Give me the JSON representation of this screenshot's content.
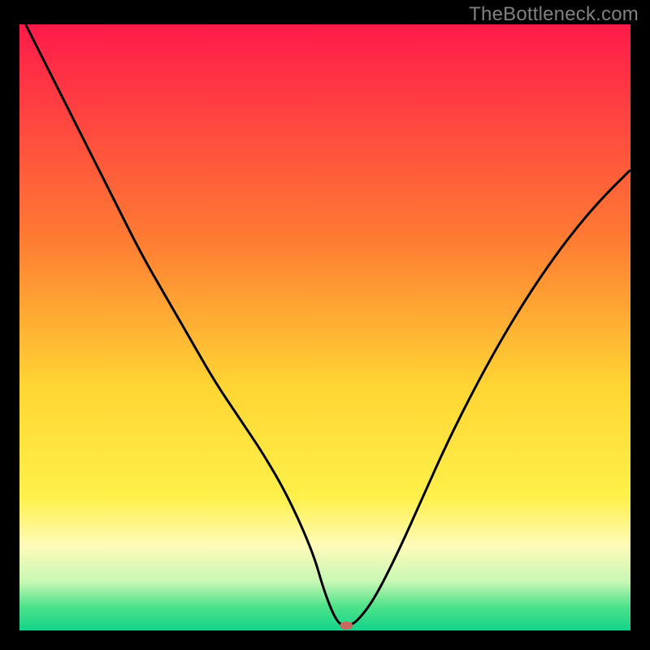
{
  "watermark": "TheBottleneck.com",
  "chart_data": {
    "type": "line",
    "title": "",
    "xlabel": "",
    "ylabel": "",
    "xlim": [
      0,
      100
    ],
    "ylim": [
      0,
      100
    ],
    "background_gradient": {
      "stops": [
        {
          "offset": 0,
          "color": "#ff1a4a"
        },
        {
          "offset": 35,
          "color": "#ff7a33"
        },
        {
          "offset": 60,
          "color": "#ffd633"
        },
        {
          "offset": 78,
          "color": "#fff04a"
        },
        {
          "offset": 86,
          "color": "#fffbb8"
        },
        {
          "offset": 92,
          "color": "#c7f7b4"
        },
        {
          "offset": 96,
          "color": "#4fe28a"
        },
        {
          "offset": 100,
          "color": "#12d48a"
        }
      ]
    },
    "series": [
      {
        "name": "bottleneck-curve",
        "color": "#000000",
        "x": [
          1,
          4,
          8,
          12,
          16,
          20,
          24,
          28,
          32,
          36,
          40,
          44,
          48,
          50,
          52,
          53.5,
          55,
          58,
          62,
          66,
          70,
          75,
          80,
          85,
          90,
          95,
          100
        ],
        "y": [
          100,
          94,
          86,
          78,
          70,
          62,
          55,
          48,
          41,
          35,
          29,
          22,
          13,
          6,
          1.2,
          0.8,
          1.2,
          5,
          13,
          22,
          31,
          41,
          50,
          58,
          65,
          71,
          76
        ]
      }
    ],
    "marker": {
      "name": "optimal-point",
      "x": 53.5,
      "y": 0.8,
      "color": "#c96a60",
      "rx": 8,
      "ry": 5
    }
  }
}
